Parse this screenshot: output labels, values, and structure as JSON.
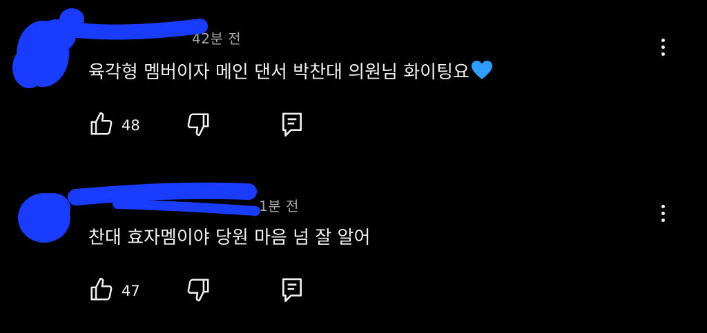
{
  "comments": [
    {
      "time": "42분 전",
      "text": "육각형 멤버이자 메인 댄서 박찬대 의원님 화이팅요",
      "emoji": "blue-heart",
      "likes": "48",
      "reply_icon": "reply-icon",
      "menu_icon": "more-vert-icon"
    },
    {
      "time": "1분 전",
      "text": "찬대 효자멤이야 당원 마음 넘 잘 알어",
      "likes": "47",
      "reply_icon": "reply-icon",
      "menu_icon": "more-vert-icon"
    }
  ],
  "colors": {
    "background": "#000000",
    "text": "#f1f1f1",
    "meta": "#aaaaaa",
    "redaction": "#1a3cff",
    "heart": "#2f9cff"
  }
}
